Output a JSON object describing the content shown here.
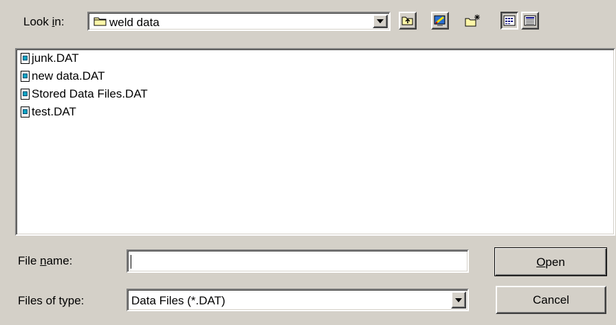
{
  "look_in": {
    "label_prefix": "Look ",
    "label_accel": "i",
    "label_suffix": "n:",
    "value": "weld data"
  },
  "toolbar": {
    "icons": [
      "up-one-level-icon",
      "desktop-icon",
      "new-folder-icon",
      "list-view-icon",
      "details-view-icon"
    ]
  },
  "files": [
    {
      "name": "junk.DAT"
    },
    {
      "name": "new data.DAT"
    },
    {
      "name": "Stored Data Files.DAT"
    },
    {
      "name": "test.DAT"
    }
  ],
  "file_name": {
    "label_prefix": "File ",
    "label_accel": "n",
    "label_suffix": "ame:",
    "value": ""
  },
  "file_type": {
    "label": "Files of type:",
    "value": "Data Files (*.DAT)"
  },
  "buttons": {
    "open_accel": "O",
    "open_rest": "pen",
    "cancel": "Cancel"
  }
}
